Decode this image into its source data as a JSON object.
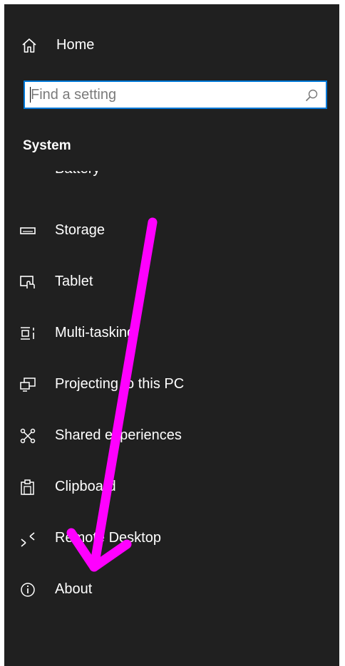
{
  "window": {
    "home_label": "Home",
    "search": {
      "placeholder": "Find a setting"
    },
    "section_title": "System"
  },
  "nav": {
    "items": [
      {
        "label": "Battery",
        "icon": "battery-icon"
      },
      {
        "label": "Storage",
        "icon": "storage-icon"
      },
      {
        "label": "Tablet",
        "icon": "tablet-icon"
      },
      {
        "label": "Multi-tasking",
        "icon": "multitasking-icon"
      },
      {
        "label": "Projecting to this PC",
        "icon": "projecting-icon"
      },
      {
        "label": "Shared experiences",
        "icon": "shared-experiences-icon"
      },
      {
        "label": "Clipboard",
        "icon": "clipboard-icon"
      },
      {
        "label": "Remote Desktop",
        "icon": "remote-desktop-icon"
      },
      {
        "label": "About",
        "icon": "about-icon"
      }
    ]
  },
  "colors": {
    "sidebar_bg": "#202020",
    "text": "#ffffff",
    "search_border": "#0078d7",
    "annotation_arrow": "#ff00ff"
  }
}
